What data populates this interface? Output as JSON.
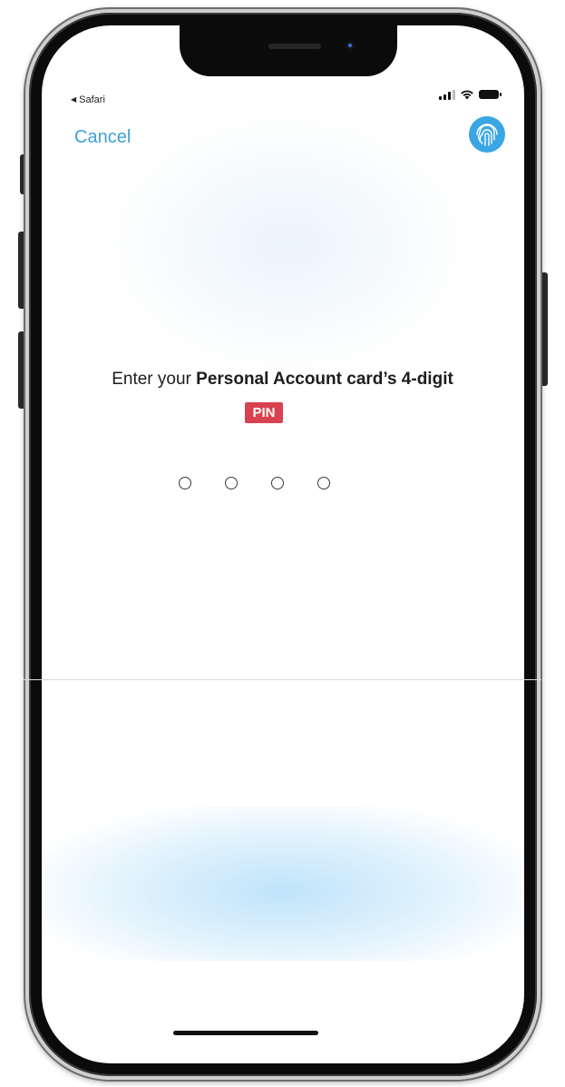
{
  "status_bar": {
    "back_app": "Safari"
  },
  "nav": {
    "cancel_label": "Cancel",
    "fingerprint_icon": "fingerprint-icon"
  },
  "prompt": {
    "lead": "Enter your",
    "emphasis": "Personal Account card’s 4-digit",
    "pin_badge": "PIN"
  },
  "pin_entry": {
    "digit_count": 4,
    "digits_entered": 0
  },
  "colors": {
    "accent": "#3ba2d9",
    "pin_badge_bg": "#d8414f"
  }
}
